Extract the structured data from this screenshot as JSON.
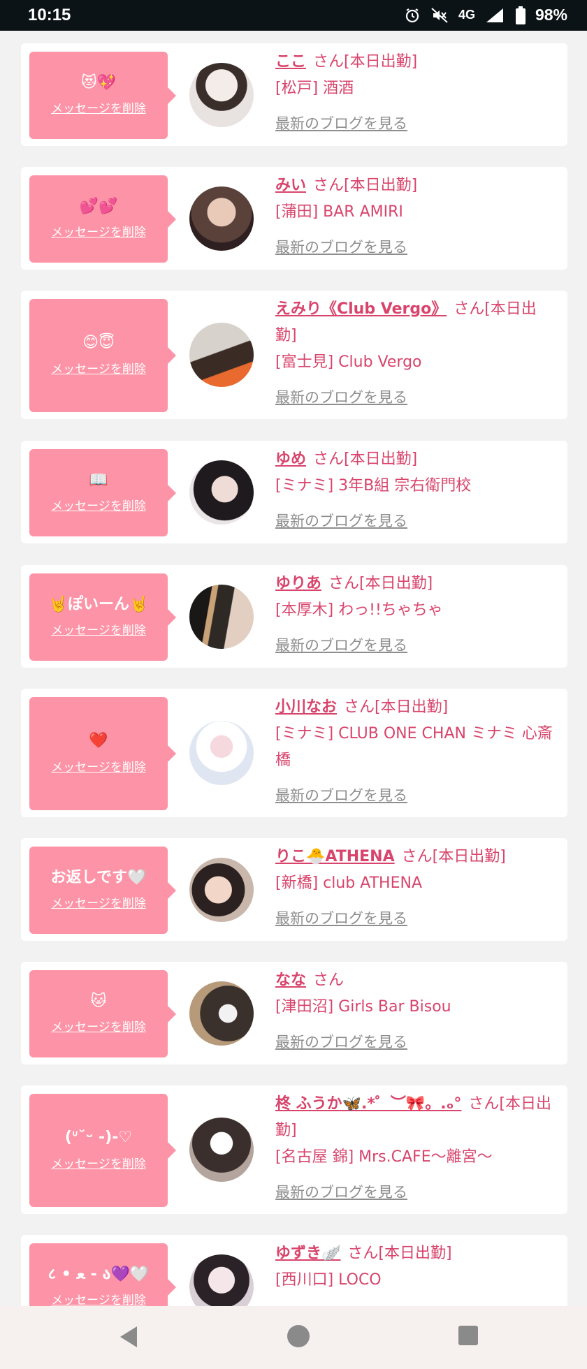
{
  "status_bar": {
    "time": "10:15",
    "network": "4G",
    "battery": "98%"
  },
  "common": {
    "delete_label": "メッセージを削除",
    "blog_label": "最新のブログを見る"
  },
  "cards": [
    {
      "message": "😻💖",
      "name": "ここ",
      "suffix": "さん[本日出勤]",
      "shop": "[松戸] 酒酒"
    },
    {
      "message": "💕💕",
      "name": "みい",
      "suffix": "さん[本日出勤]",
      "shop": "[蒲田] BAR AMIRI"
    },
    {
      "message": "😊😇",
      "name": "えみり《Club Vergo》",
      "suffix": "さん[本日出勤]",
      "shop": "[富士見] Club Vergo"
    },
    {
      "message": "📖",
      "name": "ゆめ",
      "suffix": "さん[本日出勤]",
      "shop": "[ミナミ] 3年B組 宗右衛門校"
    },
    {
      "message": "🤘ぽいーん🤘",
      "name": "ゆりあ",
      "suffix": "さん[本日出勤]",
      "shop": "[本厚木] わっ!!ちゃちゃ"
    },
    {
      "message": "❤️",
      "name": "小川なお",
      "suffix": "さん[本日出勤]",
      "shop": "[ミナミ] CLUB ONE CHAN ミナミ 心斎橋"
    },
    {
      "message": "お返しです🤍",
      "name": "りこ🐣ATHENA",
      "suffix": "さん[本日出勤]",
      "shop": "[新橋] club ATHENA"
    },
    {
      "message": "🐱",
      "name": "なな",
      "suffix": "さん",
      "shop": "[津田沼] Girls Bar Bisou"
    },
    {
      "message": "(ᐡ˘ᵕ -)-♡",
      "name": "柊 ふうか🦋.*゜︶🎀。.ₒ°",
      "suffix": "さん[本日出勤]",
      "shop": "[名古屋 錦] Mrs.CAFE〜離宮〜"
    },
    {
      "message": "८ • ﻌ - ა💜🤍",
      "name": "ゆずき🪽",
      "suffix": "さん[本日出勤]",
      "shop": "[西川口] LOCO"
    }
  ],
  "avatar_colors": [
    "#cfc9c5",
    "#6b4f4b",
    "#c7a58a",
    "#2a2428",
    "#3c3632",
    "#dfe5ef",
    "#d7b9a8",
    "#5b4c46",
    "#b7a8a2",
    "#c8c2cf"
  ]
}
